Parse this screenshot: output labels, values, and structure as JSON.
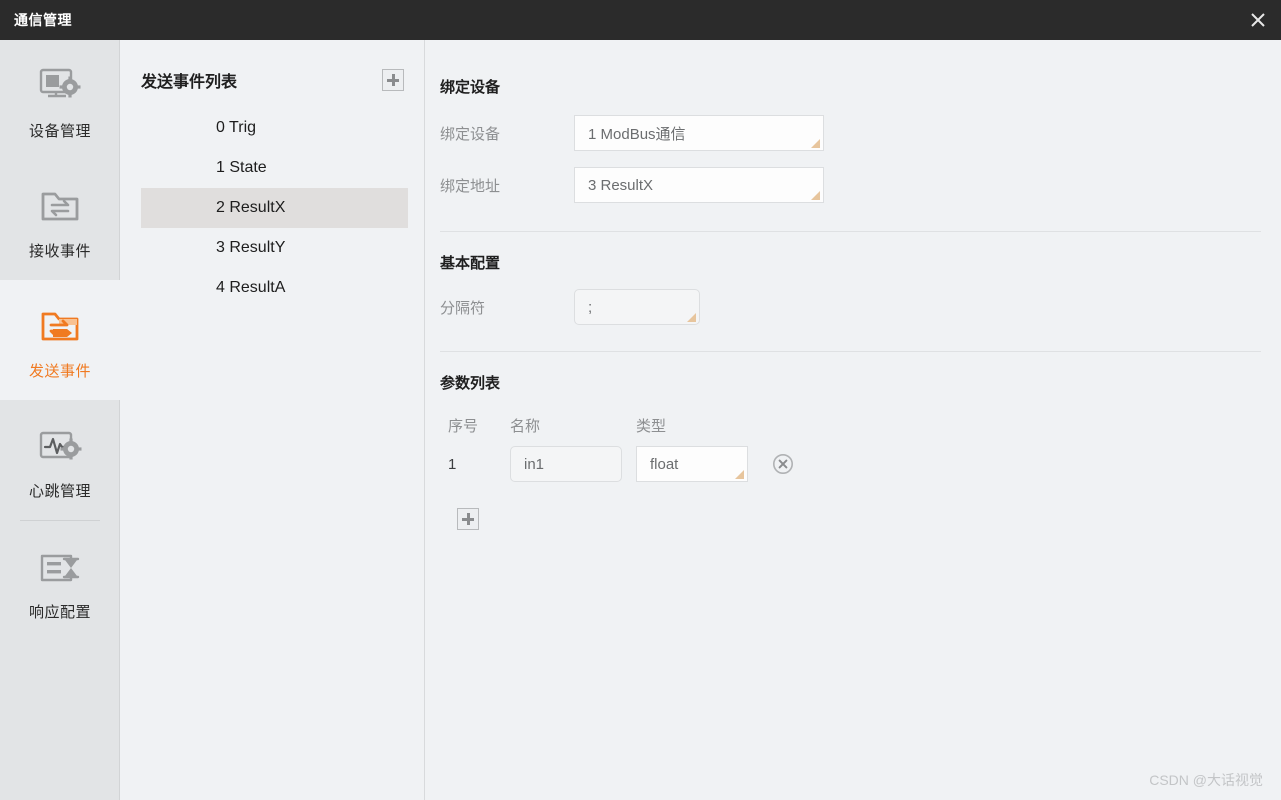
{
  "window": {
    "title": "通信管理",
    "close_icon": "close-icon"
  },
  "sidebar": {
    "items": [
      {
        "label": "设备管理",
        "icon": "monitor-gear-icon",
        "active": false
      },
      {
        "label": "接收事件",
        "icon": "folder-in-arrow-icon",
        "active": false
      },
      {
        "label": "发送事件",
        "icon": "folder-out-arrow-icon",
        "active": true
      },
      {
        "label": "心跳管理",
        "icon": "heartbeat-gear-icon",
        "active": false
      },
      {
        "label": "响应配置",
        "icon": "list-hourglass-icon",
        "active": false
      }
    ],
    "accent_color": "#f07a21"
  },
  "event_list": {
    "title": "发送事件列表",
    "add_label": "+",
    "items": [
      {
        "label": "0 Trig",
        "selected": false
      },
      {
        "label": "1 State",
        "selected": false
      },
      {
        "label": "2 ResultX",
        "selected": true
      },
      {
        "label": "3 ResultY",
        "selected": false
      },
      {
        "label": "4 ResultA",
        "selected": false
      }
    ]
  },
  "detail": {
    "bind_section": {
      "title": "绑定设备",
      "fields": [
        {
          "label": "绑定设备",
          "value": "1 ModBus通信"
        },
        {
          "label": "绑定地址",
          "value": "3 ResultX"
        }
      ]
    },
    "basic_section": {
      "title": "基本配置",
      "fields": [
        {
          "label": "分隔符",
          "value": ";"
        }
      ]
    },
    "param_section": {
      "title": "参数列表",
      "columns": [
        "序号",
        "名称",
        "类型"
      ],
      "rows": [
        {
          "index": "1",
          "name": "in1",
          "type": "float",
          "delete_icon": "circle-x-icon"
        }
      ],
      "add_label": "+"
    }
  },
  "watermark": "CSDN @大话视觉"
}
